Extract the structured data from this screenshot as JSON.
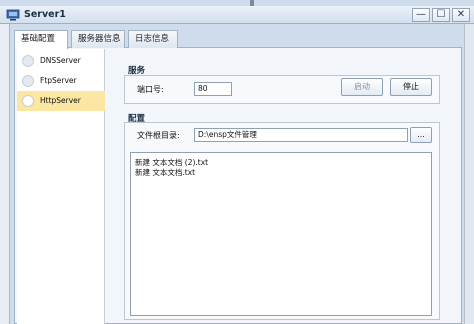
{
  "window": {
    "title": "Server1",
    "controls": {
      "minimize": "—",
      "maximize": "☐",
      "close": "✕"
    }
  },
  "tabs": [
    {
      "label": "基础配置",
      "active": true
    },
    {
      "label": "服务器信息",
      "active": false
    },
    {
      "label": "日志信息",
      "active": false
    }
  ],
  "servers": [
    {
      "label": "DNSServer",
      "selected": false
    },
    {
      "label": "FtpServer",
      "selected": false
    },
    {
      "label": "HttpServer",
      "selected": true
    }
  ],
  "service": {
    "heading": "服务",
    "port_label": "端口号:",
    "port_value": "80",
    "start_label": "启动",
    "stop_label": "停止"
  },
  "config": {
    "heading": "配置",
    "root_label": "文件根目录:",
    "root_value": "D:\\ensp文件管理",
    "browse_label": "...",
    "files": [
      "新建 文本文档 (2).txt",
      "新建 文本文档.txt"
    ]
  },
  "colors": {
    "selected_item": "#fbe7a1",
    "title_text": "#1d2f45"
  }
}
